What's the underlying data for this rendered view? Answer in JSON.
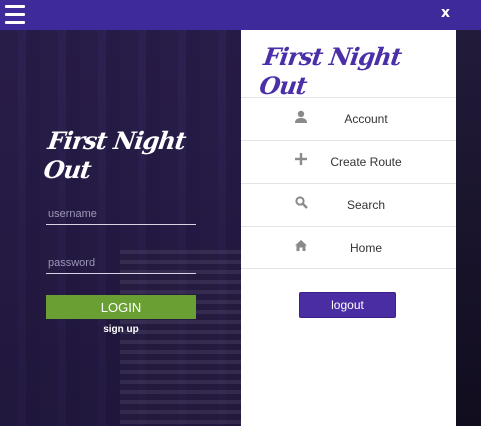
{
  "topbar": {
    "menu_icon": "hamburger-icon",
    "close_label": "x",
    "accent_color": "#3f2a9c"
  },
  "login": {
    "brand": "First Night Out",
    "username_placeholder": "username",
    "password_placeholder": "password",
    "login_label": "LOGIN",
    "signup_label": "sign up",
    "login_button_color": "#6aa033"
  },
  "menu": {
    "brand": "First Night Out",
    "items": [
      {
        "icon": "user-icon",
        "label": "Account"
      },
      {
        "icon": "plus-icon",
        "label": "Create Route"
      },
      {
        "icon": "search-icon",
        "label": "Search"
      },
      {
        "icon": "home-icon",
        "label": "Home"
      }
    ],
    "logout_label": "logout",
    "logout_color": "#4a2da3"
  }
}
